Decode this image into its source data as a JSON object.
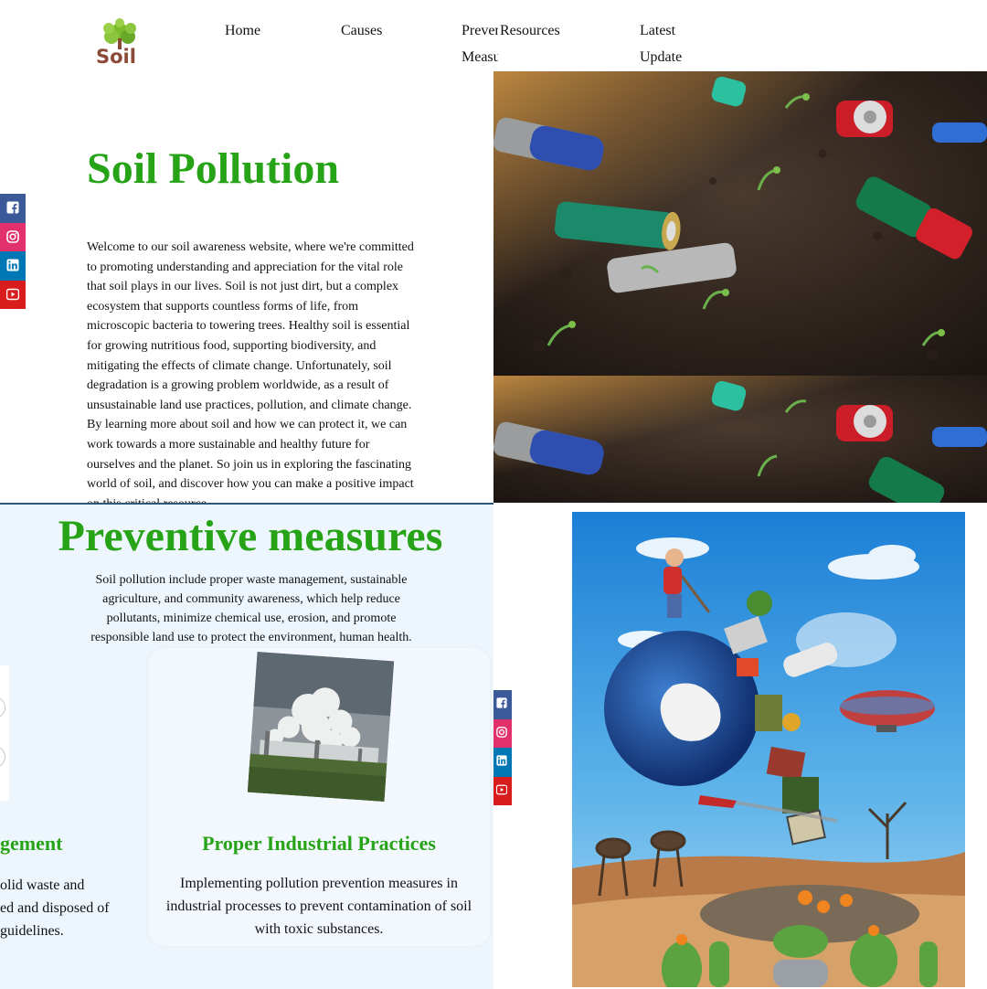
{
  "brand": {
    "logo_text": "Soil"
  },
  "nav": {
    "home": "Home",
    "causes": "Causes",
    "prevention": "Preventive Measures",
    "resources": "Resources",
    "latest": "Latest Update"
  },
  "hero": {
    "title": "Soil Pollution",
    "intro": "Welcome to our soil awareness website, where we're committed to promoting understanding and appreciation for the vital role that soil plays in our lives. Soil is not just dirt, but a complex ecosystem that supports countless forms of life, from microscopic bacteria to towering trees. Healthy soil is essential for growing nutritious food, supporting biodiversity, and mitigating the effects of climate change. Unfortunately, soil degradation is a growing problem worldwide, as a result of unsustainable land use practices, pollution, and climate change. By learning more about soil and how we can protect it, we can work towards a more sustainable and healthy future for ourselves and the planet. So join us in exploring the fascinating world of soil, and discover how you can make a positive impact on this critical resource."
  },
  "social": [
    "facebook-icon",
    "instagram-icon",
    "linkedin-icon",
    "youtube-icon"
  ],
  "preventive": {
    "title": "Preventive measures",
    "description": "Soil pollution include proper waste management, sustainable agriculture, and community awareness, which help reduce pollutants, minimize chemical use, erosion, and promote responsible land use to protect the environment, human health.",
    "left_card": {
      "title_fragment": "gement",
      "line1": "olid waste and",
      "line2": "ed and disposed of",
      "line3": "guidelines."
    },
    "industrial_card": {
      "title": "Proper Industrial Practices",
      "text": "Implementing pollution prevention measures in industrial processes to prevent contamination of soil with toxic substances."
    }
  },
  "colors": {
    "accent_green": "#27a317",
    "facebook": "#3b5998",
    "instagram": "#e1306c",
    "linkedin": "#0077b5",
    "youtube": "#d91c1c",
    "panel_bg": "#eef6fd"
  }
}
